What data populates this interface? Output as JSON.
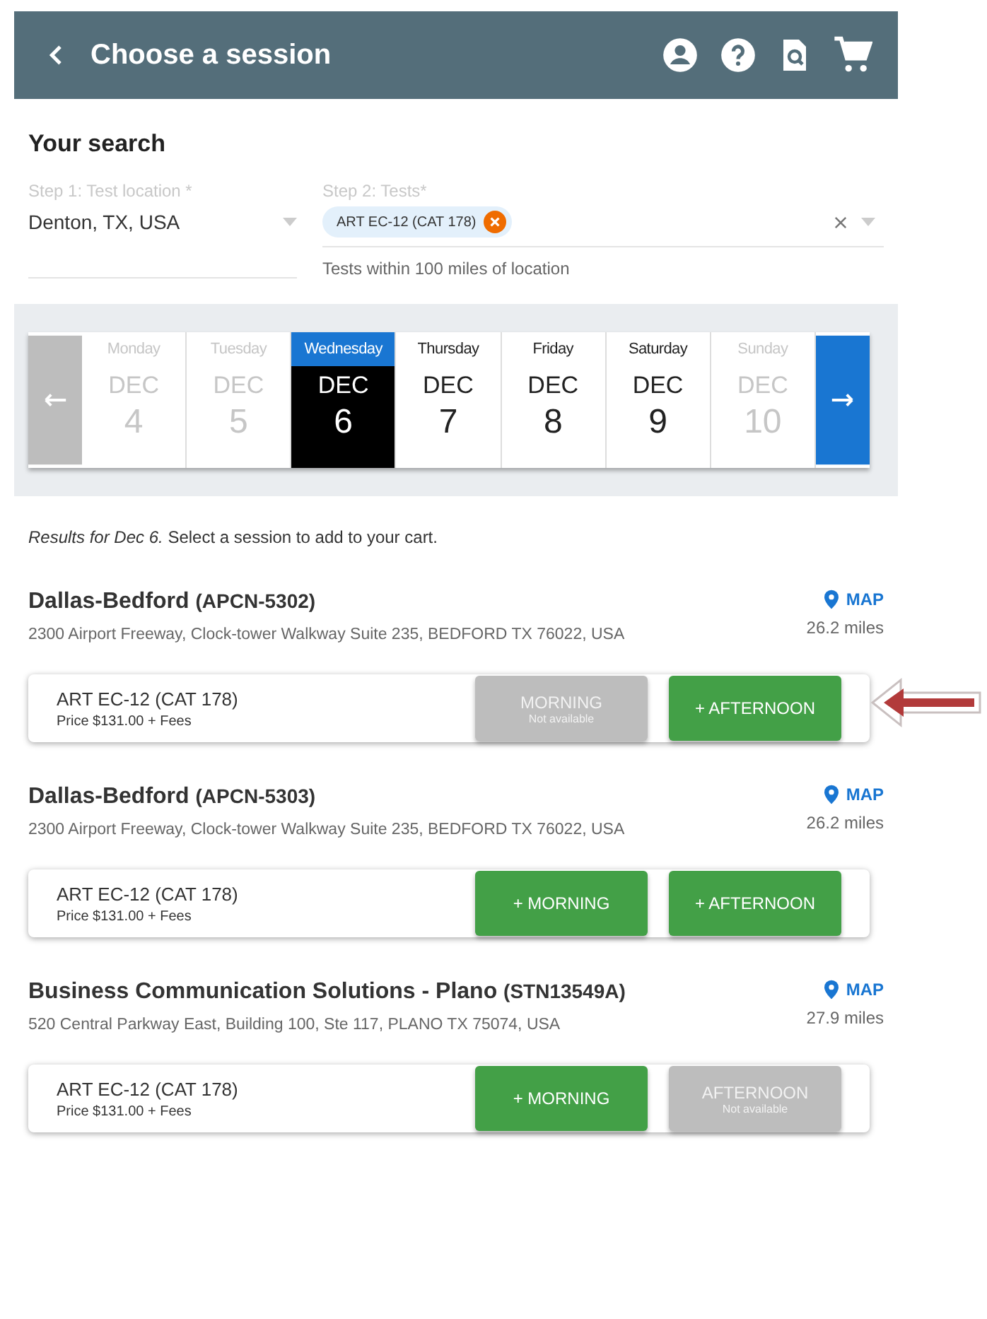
{
  "header": {
    "title": "Choose a session"
  },
  "search": {
    "heading": "Your search",
    "location": {
      "label": "Step 1: Test location *",
      "value": "Denton, TX, USA"
    },
    "tests": {
      "label": "Step 2: Tests*",
      "chips": [
        "ART EC-12 (CAT 178)"
      ],
      "hint": "Tests within 100 miles of location"
    }
  },
  "dates": [
    {
      "weekday": "Monday",
      "month": "DEC",
      "day": "4",
      "selected": false,
      "disabled": true
    },
    {
      "weekday": "Tuesday",
      "month": "DEC",
      "day": "5",
      "selected": false,
      "disabled": true
    },
    {
      "weekday": "Wednesday",
      "month": "DEC",
      "day": "6",
      "selected": true,
      "disabled": false
    },
    {
      "weekday": "Thursday",
      "month": "DEC",
      "day": "7",
      "selected": false,
      "disabled": false
    },
    {
      "weekday": "Friday",
      "month": "DEC",
      "day": "8",
      "selected": false,
      "disabled": false
    },
    {
      "weekday": "Saturday",
      "month": "DEC",
      "day": "9",
      "selected": false,
      "disabled": false
    },
    {
      "weekday": "Sunday",
      "month": "DEC",
      "day": "10",
      "selected": false,
      "disabled": true
    }
  ],
  "results_note": "*Results for Dec 6.* Select a session to add to your cart.",
  "centers": [
    {
      "name": "Dallas-Bedford",
      "code": "(APCN-5302)",
      "address": "2300 Airport Freeway, Clock-tower Walkway Suite 235, BEDFORD TX 76022, USA",
      "map": "MAP",
      "distance": "26.2 miles",
      "test": "ART EC-12 (CAT 178)",
      "price": "Price $131.00 + Fees",
      "annotated": true,
      "sessions": [
        {
          "label": "MORNING",
          "note": "Not available",
          "available": false
        },
        {
          "label": "+ AFTERNOON",
          "available": true
        }
      ]
    },
    {
      "name": "Dallas-Bedford",
      "code": "(APCN-5303)",
      "address": "2300 Airport Freeway, Clock-tower Walkway Suite 235, BEDFORD TX 76022, USA",
      "map": "MAP",
      "distance": "26.2 miles",
      "test": "ART EC-12 (CAT 178)",
      "price": "Price $131.00 + Fees",
      "annotated": false,
      "sessions": [
        {
          "label": "+ MORNING",
          "available": true
        },
        {
          "label": "+ AFTERNOON",
          "available": true
        }
      ]
    },
    {
      "name": "Business Communication Solutions - Plano",
      "code": "(STN13549A)",
      "address": "520 Central Parkway East, Building 100, Ste 117, PLANO TX 75074, USA",
      "map": "MAP",
      "distance": "27.9 miles",
      "test": "ART EC-12 (CAT 178)",
      "price": "Price $131.00 + Fees",
      "annotated": false,
      "sessions": [
        {
          "label": "+ MORNING",
          "available": true
        },
        {
          "label": "AFTERNOON",
          "note": "Not available",
          "available": false
        }
      ]
    }
  ]
}
